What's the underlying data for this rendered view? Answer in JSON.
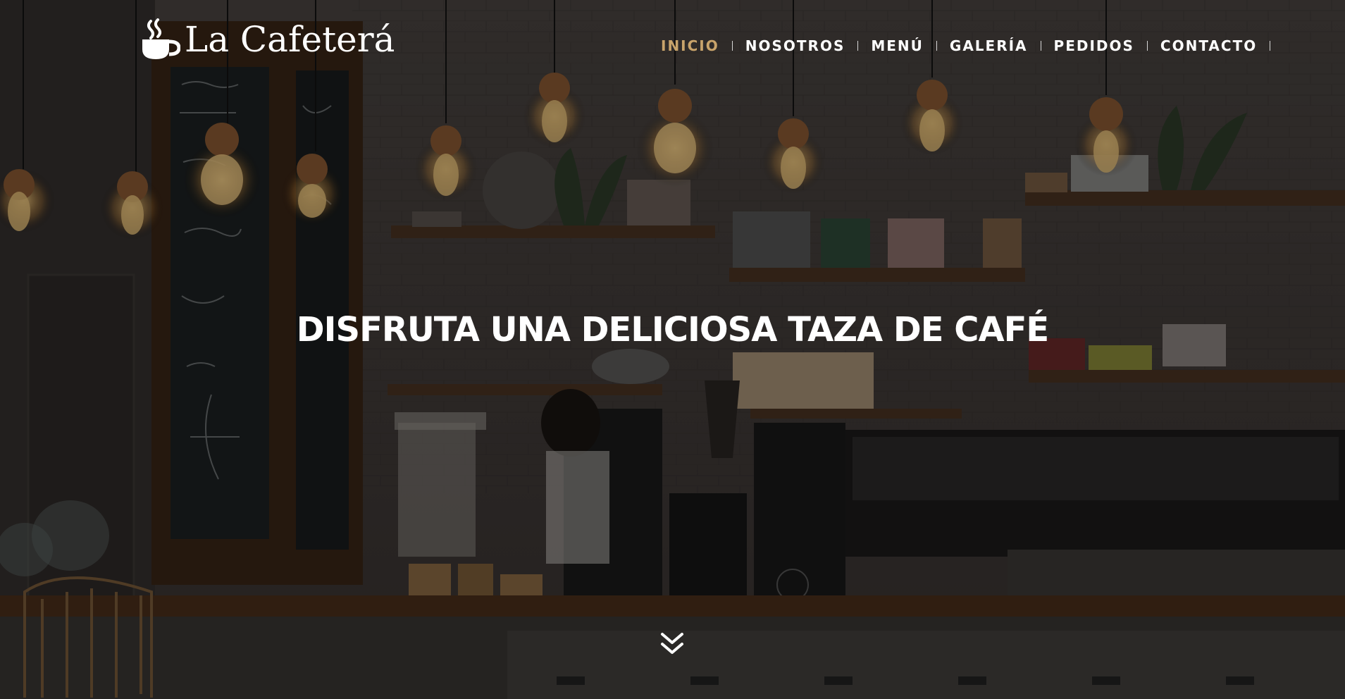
{
  "brand": {
    "name": "La Cafeterá",
    "logo_icon": "coffee-cup-icon",
    "color": "#ffffff"
  },
  "nav": {
    "items": [
      {
        "label": "INICIO",
        "active": true
      },
      {
        "label": "NOSOTROS",
        "active": false
      },
      {
        "label": "MENÚ",
        "active": false
      },
      {
        "label": "GALERÍA",
        "active": false
      },
      {
        "label": "PEDIDOS",
        "active": false
      },
      {
        "label": "CONTACTO",
        "active": false
      }
    ],
    "active_color": "#c9a46b",
    "color": "#ffffff"
  },
  "hero": {
    "headline": "DISFRUTA UNA DELICIOSA TAZA DE CAFÉ",
    "background": "cafe-interior-photo",
    "scroll_icon": "double-chevron-down-icon"
  }
}
